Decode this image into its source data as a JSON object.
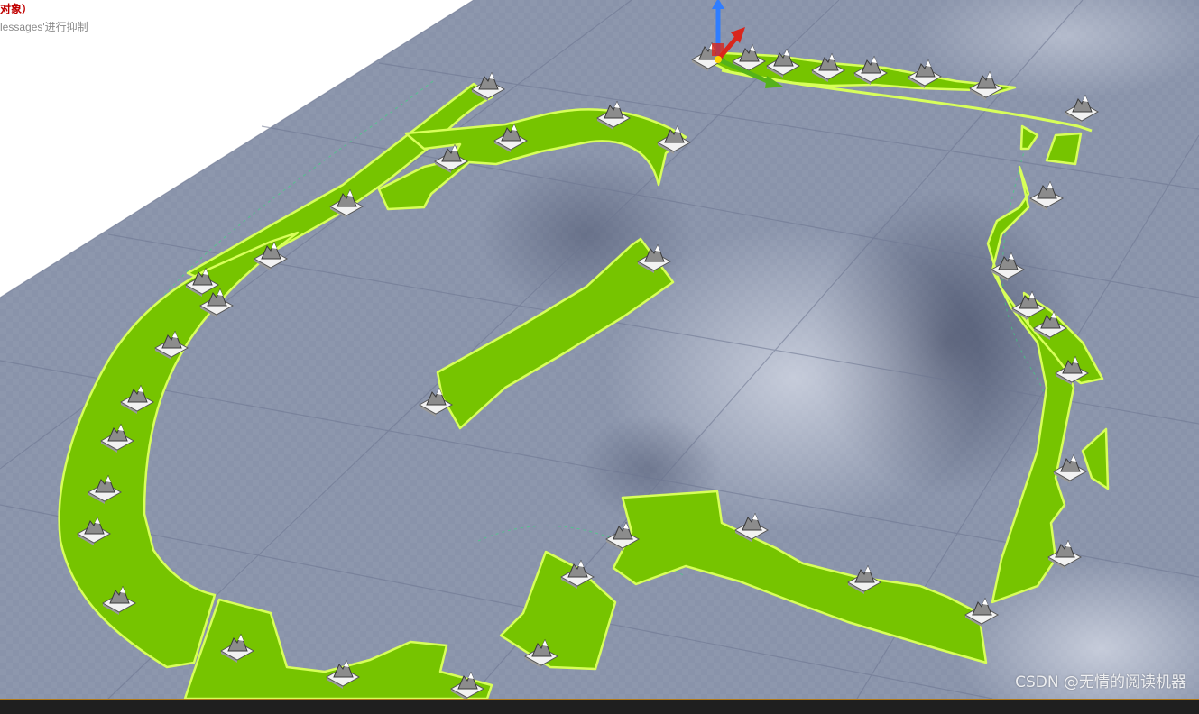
{
  "viewport": {
    "warning_text": "对象）",
    "hint_text": "lessages'进行抑制",
    "watermark": "CSDN @无情的阅读机器"
  },
  "colors": {
    "sky": "#ffffff",
    "ground": "#8e97ad",
    "ground_dark": "#5f6880",
    "road_fill": "#76c400",
    "road_edge": "#d8ff5a",
    "bottom_bar": "#1f1f1f",
    "bottom_accent": "#b07a19",
    "gizmo_z": "#2f7dff",
    "gizmo_x": "#d9261c",
    "gizmo_y": "#55b21a"
  },
  "icons": {
    "spline_point": "landscape-spline-control-point-icon",
    "gizmo": "transform-gizmo-icon"
  }
}
